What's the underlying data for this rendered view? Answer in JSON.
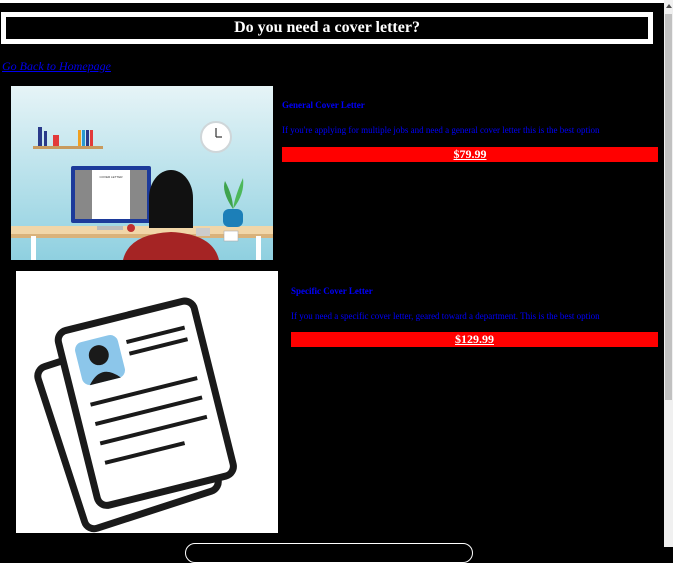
{
  "header": {
    "title": "Do you need a cover letter?"
  },
  "nav": {
    "back_link": "Go Back to Homepage"
  },
  "products": [
    {
      "title": "General Cover Letter",
      "description": "If you're applying for multiple jobs and need a general cover letter this is the best option",
      "price": "$79.99",
      "image_label": "COVER LETTER"
    },
    {
      "title": "Specific Cover Letter",
      "description": "If you need a specific cover letter, geared toward a department. This is the best option",
      "price": "$129.99"
    }
  ],
  "colors": {
    "accent": "#ff0000",
    "link": "#0000ff",
    "background": "#000000"
  }
}
